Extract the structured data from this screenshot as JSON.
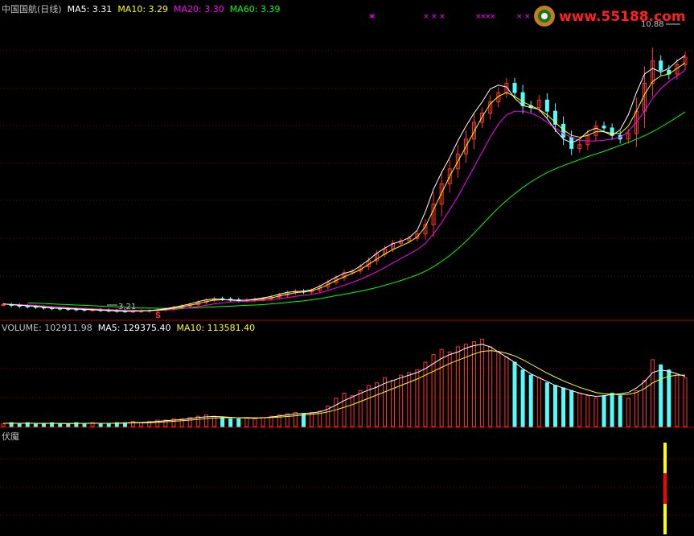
{
  "price_panel": {
    "title": "中国国航(日线)",
    "ma5_label": "MA5: 3.31",
    "ma10_label": "MA10: 3.29",
    "ma20_label": "MA20: 3.30",
    "ma60_label": "MA60: 3.39",
    "high_marker": "10.88",
    "low_marker": "3.21",
    "event_marker": "S"
  },
  "volume_panel": {
    "volume_label": "VOLUME: 102911.98",
    "ma5_label": "MA5: 129375.40",
    "ma10_label": "MA10: 113581.40"
  },
  "indicator_panel": {
    "title": "伏魔"
  },
  "logo": {
    "text": "www.55188.com"
  },
  "colors": {
    "background": "#000000",
    "title": "#c0c0c0",
    "ma5": "#ffffff",
    "ma10": "#ffff00",
    "ma20": "#ff00ff",
    "ma60": "#00ff00",
    "up_candle": "#ff3232",
    "down_candle": "#54fcfc",
    "grid": "#8b0000",
    "border": "#b00000",
    "logo_red": "#ff2020",
    "marker": "#ff00ff"
  },
  "chart_data": [
    {
      "type": "candlestick",
      "name": "price",
      "x": [
        0,
        10,
        20,
        30,
        40,
        50,
        60,
        70,
        80,
        90,
        100,
        110,
        120,
        130,
        140,
        150,
        160,
        170,
        180,
        190,
        200,
        210,
        220,
        230,
        240,
        250,
        260,
        270,
        280,
        290,
        300,
        310,
        320,
        330,
        340,
        350,
        360,
        370,
        380,
        390,
        400,
        410,
        420,
        430,
        440,
        450,
        460,
        470,
        480,
        490,
        500,
        510,
        520,
        530,
        540,
        550,
        560,
        570,
        580,
        590,
        600,
        610,
        620,
        630,
        640,
        650,
        660,
        670,
        680,
        690,
        700,
        710,
        720,
        730,
        740,
        750,
        760,
        770,
        780,
        790,
        800,
        810,
        820,
        830,
        840
      ],
      "close": [
        3.4,
        3.38,
        3.36,
        3.35,
        3.33,
        3.31,
        3.3,
        3.29,
        3.28,
        3.27,
        3.26,
        3.26,
        3.25,
        3.24,
        3.23,
        3.22,
        3.22,
        3.23,
        3.24,
        3.26,
        3.28,
        3.32,
        3.36,
        3.4,
        3.46,
        3.52,
        3.56,
        3.55,
        3.53,
        3.51,
        3.52,
        3.54,
        3.56,
        3.6,
        3.66,
        3.72,
        3.76,
        3.74,
        3.78,
        3.88,
        4.0,
        4.12,
        4.26,
        4.3,
        4.42,
        4.58,
        4.76,
        4.9,
        5.05,
        5.12,
        5.18,
        5.3,
        5.55,
        6.1,
        6.65,
        7.05,
        7.45,
        7.85,
        8.3,
        8.55,
        8.85,
        9.1,
        9.35,
        9.1,
        8.75,
        8.7,
        8.9,
        8.6,
        8.25,
        7.9,
        7.6,
        7.7,
        7.95,
        8.2,
        8.15,
        7.95,
        7.85,
        8.0,
        8.6,
        9.35,
        9.95,
        9.7,
        9.6,
        9.85,
        10.05
      ],
      "ma5": [
        3.42,
        3.4,
        3.38,
        3.37,
        3.35,
        3.33,
        3.31,
        3.3,
        3.29,
        3.28,
        3.27,
        3.26,
        3.25,
        3.24,
        3.23,
        3.22,
        3.22,
        3.23,
        3.24,
        3.26,
        3.29,
        3.33,
        3.37,
        3.42,
        3.48,
        3.53,
        3.55,
        3.54,
        3.52,
        3.51,
        3.52,
        3.55,
        3.58,
        3.62,
        3.68,
        3.73,
        3.75,
        3.76,
        3.8,
        3.9,
        4.02,
        4.14,
        4.24,
        4.3,
        4.44,
        4.6,
        4.78,
        4.92,
        5.04,
        5.1,
        5.2,
        5.4,
        5.9,
        6.5,
        6.95,
        7.35,
        7.8,
        8.2,
        8.55,
        8.85,
        9.2,
        9.3,
        9.25,
        8.95,
        8.75,
        8.7,
        8.65,
        8.4,
        8.1,
        7.85,
        7.75,
        7.85,
        8.05,
        8.15,
        8.05,
        7.95,
        8.1,
        8.5,
        9.1,
        9.6,
        9.75,
        9.65,
        9.75,
        9.95,
        10.1
      ],
      "ma10": [
        3.42,
        3.4,
        3.39,
        3.37,
        3.36,
        3.34,
        3.32,
        3.31,
        3.3,
        3.29,
        3.28,
        3.27,
        3.26,
        3.25,
        3.24,
        3.23,
        3.23,
        3.23,
        3.24,
        3.25,
        3.27,
        3.3,
        3.34,
        3.38,
        3.43,
        3.48,
        3.52,
        3.53,
        3.53,
        3.52,
        3.52,
        3.53,
        3.55,
        3.58,
        3.63,
        3.68,
        3.72,
        3.74,
        3.77,
        3.84,
        3.94,
        4.05,
        4.15,
        4.24,
        4.34,
        4.48,
        4.62,
        4.76,
        4.88,
        4.98,
        5.08,
        5.22,
        5.5,
        5.95,
        6.4,
        6.85,
        7.25,
        7.65,
        8.05,
        8.45,
        8.8,
        9.0,
        9.1,
        9.0,
        8.85,
        8.75,
        8.65,
        8.5,
        8.3,
        8.1,
        7.95,
        7.9,
        7.95,
        8.05,
        8.05,
        8.0,
        8.0,
        8.2,
        8.6,
        9.05,
        9.4,
        9.55,
        9.6,
        9.75,
        9.9
      ],
      "ma20": [
        3.42,
        3.41,
        3.4,
        3.39,
        3.38,
        3.36,
        3.35,
        3.34,
        3.32,
        3.31,
        3.3,
        3.29,
        3.28,
        3.27,
        3.26,
        3.25,
        3.25,
        3.24,
        3.24,
        3.24,
        3.25,
        3.27,
        3.29,
        3.32,
        3.35,
        3.38,
        3.42,
        3.45,
        3.47,
        3.48,
        3.49,
        3.5,
        3.51,
        3.53,
        3.56,
        3.59,
        3.62,
        3.65,
        3.68,
        3.72,
        3.78,
        3.85,
        3.92,
        4.0,
        4.08,
        4.18,
        4.28,
        4.4,
        4.52,
        4.64,
        4.76,
        4.88,
        5.05,
        5.3,
        5.6,
        5.95,
        6.3,
        6.7,
        7.1,
        7.5,
        7.9,
        8.25,
        8.5,
        8.6,
        8.6,
        8.55,
        8.45,
        8.3,
        8.15,
        8.0,
        7.9,
        7.82,
        7.8,
        7.8,
        7.82,
        7.85,
        7.9,
        8.05,
        8.3,
        8.6,
        8.95,
        9.2,
        9.4,
        9.55,
        9.7
      ],
      "ma60": [
        null,
        null,
        null,
        3.45,
        3.44,
        3.43,
        3.42,
        3.41,
        3.4,
        3.39,
        3.38,
        3.37,
        3.36,
        3.35,
        3.34,
        3.33,
        3.32,
        3.31,
        3.31,
        3.3,
        3.3,
        3.3,
        3.31,
        3.31,
        3.32,
        3.33,
        3.34,
        3.35,
        3.36,
        3.37,
        3.38,
        3.39,
        3.4,
        3.42,
        3.44,
        3.46,
        3.48,
        3.5,
        3.53,
        3.56,
        3.6,
        3.64,
        3.68,
        3.72,
        3.76,
        3.81,
        3.86,
        3.92,
        3.98,
        4.05,
        4.12,
        4.2,
        4.3,
        4.42,
        4.56,
        4.72,
        4.9,
        5.1,
        5.32,
        5.55,
        5.78,
        6.0,
        6.2,
        6.38,
        6.55,
        6.7,
        6.83,
        6.95,
        7.05,
        7.14,
        7.22,
        7.3,
        7.38,
        7.45,
        7.52,
        7.6,
        7.68,
        7.76,
        7.85,
        7.94,
        8.05,
        8.17,
        8.3,
        8.44,
        8.58
      ],
      "ylim": [
        3.0,
        11.2
      ]
    },
    {
      "type": "bar",
      "name": "volume",
      "values": [
        2,
        3,
        2,
        3,
        2,
        2,
        3,
        2,
        2,
        3,
        2,
        3,
        2,
        2,
        3,
        3,
        4,
        3,
        4,
        5,
        5,
        6,
        6,
        7,
        8,
        9,
        8,
        7,
        6,
        6,
        7,
        6,
        7,
        8,
        9,
        10,
        11,
        10,
        11,
        12,
        16,
        22,
        26,
        24,
        28,
        32,
        34,
        38,
        36,
        40,
        42,
        44,
        50,
        56,
        60,
        58,
        62,
        64,
        66,
        68,
        62,
        58,
        54,
        50,
        44,
        40,
        38,
        34,
        32,
        30,
        28,
        26,
        24,
        22,
        24,
        26,
        24,
        22,
        28,
        36,
        52,
        48,
        44,
        40,
        38
      ],
      "ma5": [
        2.5,
        2.6,
        2.5,
        2.6,
        2.5,
        2.4,
        2.5,
        2.4,
        2.4,
        2.5,
        2.5,
        2.6,
        2.5,
        2.5,
        2.6,
        2.8,
        3.1,
        3.2,
        3.5,
        4.0,
        4.5,
        5.0,
        5.5,
        6.2,
        7.0,
        7.6,
        7.8,
        7.6,
        7.2,
        6.8,
        6.6,
        6.5,
        6.8,
        7.4,
        8.2,
        9.0,
        9.8,
        10.2,
        10.6,
        11.4,
        13.6,
        16.8,
        20.2,
        23.0,
        25.8,
        28.4,
        30.6,
        33.6,
        35.8,
        38.0,
        40.0,
        42.0,
        45.0,
        49.0,
        53.0,
        56.0,
        58.0,
        61.0,
        63.0,
        64.0,
        62.0,
        58.0,
        54.0,
        50.0,
        45.0,
        41.0,
        38.0,
        35.0,
        32.0,
        30.0,
        28.0,
        26.0,
        24.5,
        23.5,
        24.0,
        25.0,
        25.5,
        26.5,
        30.0,
        35.0,
        42.0,
        44.0,
        43.0,
        41.0,
        39.0
      ],
      "ma10": [
        2.5,
        2.5,
        2.5,
        2.5,
        2.5,
        2.5,
        2.5,
        2.5,
        2.4,
        2.4,
        2.5,
        2.5,
        2.5,
        2.5,
        2.5,
        2.6,
        2.8,
        2.9,
        3.0,
        3.3,
        3.7,
        4.1,
        4.5,
        5.0,
        5.6,
        6.2,
        6.6,
        6.8,
        6.9,
        6.9,
        6.9,
        6.8,
        6.8,
        7.0,
        7.3,
        7.8,
        8.4,
        9.0,
        9.6,
        10.2,
        11.4,
        13.0,
        15.0,
        17.0,
        19.5,
        22.0,
        24.5,
        27.0,
        29.5,
        32.0,
        34.5,
        37.0,
        40.0,
        43.0,
        46.0,
        49.0,
        51.5,
        54.0,
        56.5,
        58.5,
        59.0,
        58.5,
        57.0,
        55.0,
        52.0,
        48.5,
        45.0,
        41.5,
        38.5,
        35.5,
        33.0,
        30.5,
        28.5,
        26.5,
        25.5,
        25.0,
        24.8,
        25.0,
        26.5,
        29.5,
        34.0,
        37.0,
        39.0,
        40.0,
        40.0
      ]
    },
    {
      "type": "bar",
      "name": "伏魔",
      "signal_x": [
        827
      ],
      "segments": [
        "yellow",
        "red",
        "yellow"
      ]
    }
  ]
}
